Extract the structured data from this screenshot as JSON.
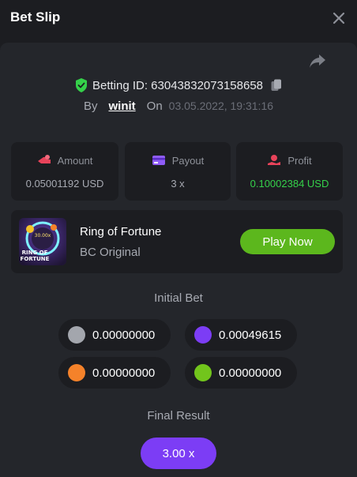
{
  "header": {
    "title": "Bet Slip"
  },
  "bet": {
    "id_label": "Betting ID: 63043832073158658",
    "by_label": "By",
    "user": "winit",
    "on_label": "On",
    "date": "03.05.2022, 19:31:16"
  },
  "stats": [
    {
      "label": "Amount",
      "value": "0.05001192 USD",
      "icon": "amount-icon"
    },
    {
      "label": "Payout",
      "value": "3 x",
      "icon": "payout-icon"
    },
    {
      "label": "Profit",
      "value": "0.10002384 USD",
      "icon": "profit-icon"
    }
  ],
  "game": {
    "name": "Ring of Fortune",
    "provider": "BC Original",
    "play_label": "Play Now",
    "thumb_multiplier": "30.00x",
    "thumb_line1": "RING OF",
    "thumb_line2": "FORTUNE"
  },
  "initial_bet": {
    "title": "Initial Bet",
    "coins": [
      {
        "color": "#a3a6ad",
        "amount": "0.00000000"
      },
      {
        "color": "#7c3df5",
        "amount": "0.00049615"
      },
      {
        "color": "#f5822a",
        "amount": "0.00000000"
      },
      {
        "color": "#72c51c",
        "amount": "0.00000000"
      }
    ]
  },
  "final_result": {
    "title": "Final Result",
    "value": "3.00 x"
  },
  "colors": {
    "accent_green": "#5cb71d",
    "accent_purple": "#7c3df5",
    "profit_green": "#35d14a"
  }
}
